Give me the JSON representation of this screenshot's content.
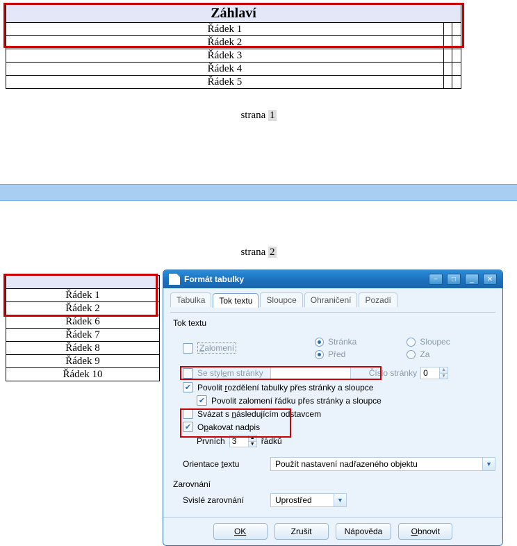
{
  "page1": {
    "header": "Záhlaví",
    "rows": [
      "Řádek 1",
      "Řádek 2",
      "Řádek 3",
      "Řádek 4",
      "Řádek 5"
    ],
    "footer_prefix": "strana ",
    "footer_num": "1"
  },
  "page2": {
    "footer_prefix": "strana ",
    "footer_num": "2",
    "rows": [
      "Řádek 1",
      "Řádek 2",
      "Řádek 6",
      "Řádek 7",
      "Řádek 8",
      "Řádek 9",
      "Řádek 10"
    ]
  },
  "dialog": {
    "title": "Formát tabulky",
    "tabs": {
      "tabulka": "Tabulka",
      "tok_textu": "Tok textu",
      "sloupce": "Sloupce",
      "ohraniceni": "Ohraničení",
      "pozadi": "Pozadí"
    },
    "section_tok": "Tok textu",
    "chk_zalomeni_pre": "Z",
    "chk_zalomeni": "alomení",
    "rad_stranka": "Stránka",
    "rad_sloupec": "Sloupec",
    "rad_pred": "Před",
    "rad_za": "Za",
    "chk_stylem_pre": "Se styl",
    "chk_stylem_mid": "e",
    "chk_stylem_post": "m stránky",
    "lbl_cislo": "Číslo stránky",
    "cislo_val": "0",
    "chk_rozdeleni_pre": "Povolit ",
    "chk_rozdeleni_u": "r",
    "chk_rozdeleni_post": "ozdělení tabulky přes stránky a sloupce",
    "chk_zalomeni_radku": "Povolit zalomení řádku přes stránky a sloupce",
    "chk_svazat_pre": "Svázat s ",
    "chk_svazat_u": "n",
    "chk_svazat_post": "ásledujícím odstavcem",
    "chk_opakovat_pre": "O",
    "chk_opakovat_u": "p",
    "chk_opakovat_post": "akovat nadpis",
    "lbl_prvnich": "Prvních",
    "prvnich_val": "3",
    "lbl_radku": "řádků",
    "lbl_orientace_pre": "Orientace ",
    "lbl_orientace_u": "t",
    "lbl_orientace_post": "extu",
    "combo_orientace": "Použít nastavení nadřazeného objektu",
    "section_align": "Zarovnání",
    "lbl_svisle": "Svislé zarovnání",
    "combo_svisle": "Uprostřed",
    "btn_ok": "OK",
    "btn_cancel": "Zrušit",
    "btn_help": "Nápověda",
    "btn_reset": "Obnovit"
  }
}
